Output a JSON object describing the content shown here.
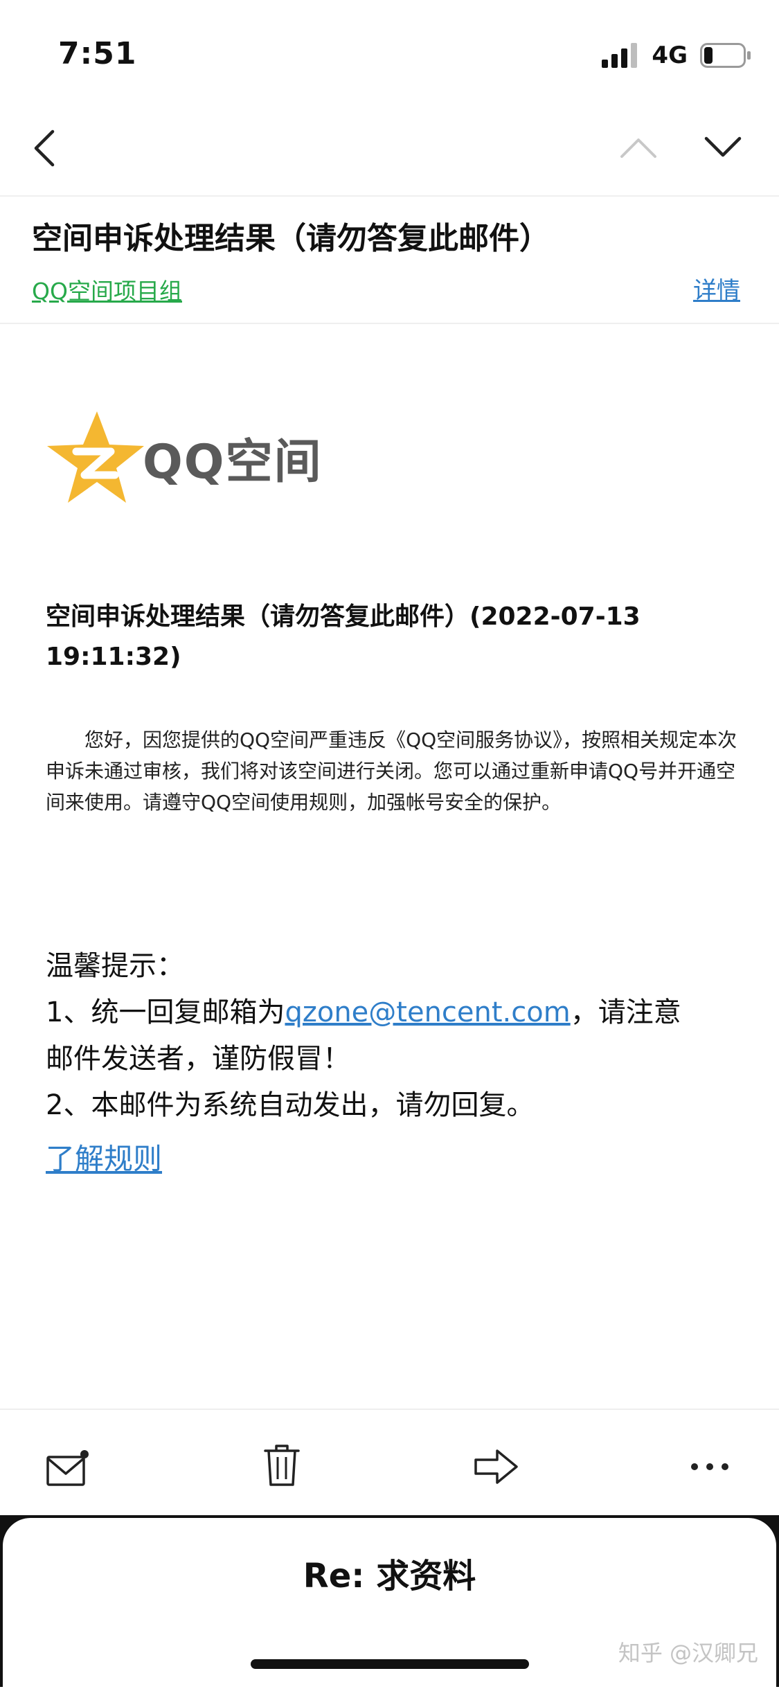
{
  "status_bar": {
    "time": "7:51",
    "network": "4G"
  },
  "nav": {
    "back_icon": "chevron-left-icon",
    "prev_icon": "chevron-up-icon",
    "next_icon": "chevron-down-icon"
  },
  "header": {
    "subject": "空间申诉处理结果（请勿答复此邮件）",
    "sender": "QQ空间项目组",
    "details_label": "详情"
  },
  "body": {
    "logo_text": "QQ空间",
    "title": "空间申诉处理结果（请勿答复此邮件）(2022-07-13 19:11:32)",
    "paragraph": "您好，因您提供的QQ空间严重违反《QQ空间服务协议》，按照相关规定本次申诉未通过审核，我们将对该空间进行关闭。您可以通过重新申请QQ号并开通空间来使用。请遵守QQ空间使用规则，加强帐号安全的保护。",
    "tips": {
      "heading": "温馨提示：",
      "line1_prefix": "1、统一回复邮箱为",
      "email": "qzone@tencent.com",
      "line1_suffix": "，请注意",
      "line2": "邮件发送者，谨防假冒！",
      "line3": "2、本邮件为系统自动发出，请勿回复。"
    },
    "rules_link": "了解规则"
  },
  "toolbar": {
    "icons": [
      "mail-icon",
      "trash-icon",
      "forward-icon",
      "more-icon"
    ]
  },
  "bottom_sheet": {
    "title": "Re: 求资料"
  },
  "watermark": "知乎 @汉卿兄",
  "colors": {
    "link_blue": "#2f7ec9",
    "sender_green": "#27a94a",
    "star_gold": "#f4b731"
  }
}
